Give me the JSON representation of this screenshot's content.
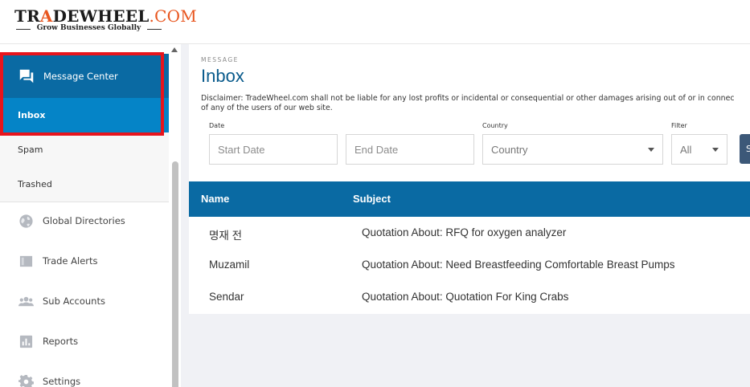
{
  "brand": {
    "part1": "TR",
    "part2": "A",
    "part3": "DEWHEEL",
    "part4": ".COM",
    "tagline": "Grow Businesses Globally"
  },
  "sidebar": {
    "message_center": "Message Center",
    "sub_items": [
      "Inbox",
      "Spam",
      "Trashed"
    ],
    "nav_items": [
      {
        "label": "Global Directories",
        "icon": "globe-icon"
      },
      {
        "label": "Trade Alerts",
        "icon": "trade-alerts-icon"
      },
      {
        "label": "Sub Accounts",
        "icon": "users-icon"
      },
      {
        "label": "Reports",
        "icon": "bar-chart-icon"
      },
      {
        "label": "Settings",
        "icon": "gear-icon"
      }
    ]
  },
  "page": {
    "eyebrow": "MESSAGE",
    "title": "Inbox",
    "disclaimer_line1": "Disclaimer: TradeWheel.com shall not be liable for any lost profits or incidental or consequential or other damages arising out of or in connec",
    "disclaimer_line2": "of any of the users of our web site."
  },
  "filters": {
    "date_label": "Date",
    "start_placeholder": "Start Date",
    "end_placeholder": "End Date",
    "country_label": "Country",
    "country_value": "Country",
    "filter_label": "Filter",
    "filter_value": "All",
    "search_button": "S"
  },
  "table": {
    "headers": [
      "Name",
      "Subject"
    ],
    "rows": [
      {
        "name": "명재 전",
        "subject": "Quotation About: RFQ for oxygen analyzer"
      },
      {
        "name": "Muzamil",
        "subject": "Quotation About: Need Breastfeeding Comfortable Breast Pumps"
      },
      {
        "name": "Sendar",
        "subject": "Quotation About: Quotation For King Crabs"
      }
    ]
  },
  "colors": {
    "primary": "#0a6aa3",
    "active_item": "#0584c7",
    "highlight_border": "#e8141c",
    "brand_orange": "#e8561f"
  }
}
